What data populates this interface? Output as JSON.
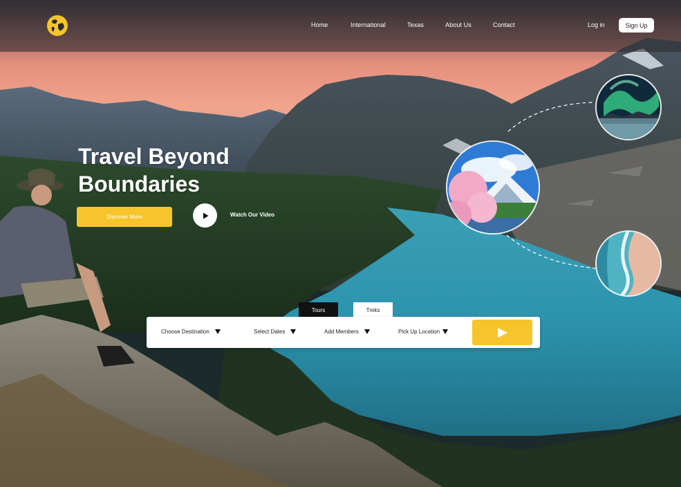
{
  "brand": {
    "logo_icon": "globe-icon",
    "accent": "#f5c52b"
  },
  "nav": {
    "links": [
      "Home",
      "International",
      "Texas",
      "About Us",
      "Contact"
    ],
    "login": "Log in",
    "signup": "Sign Up"
  },
  "hero": {
    "title_line1": "Travel Beyond",
    "title_line2": "Boundaries",
    "discover_label": "Discover More",
    "watch_label": "Watch Our Video",
    "play_icon": "play-icon"
  },
  "gallery": {
    "items": [
      "aurora-photo",
      "cherry-blossom-mountain-photo",
      "beach-shore-photo"
    ]
  },
  "search": {
    "tabs": [
      "Tours",
      "Treks"
    ],
    "active_tab": "Treks",
    "fields": [
      "Choose Destination",
      "Select Dates",
      "Add Members",
      "Pick Up Location"
    ],
    "submit_icon": "play-icon"
  }
}
